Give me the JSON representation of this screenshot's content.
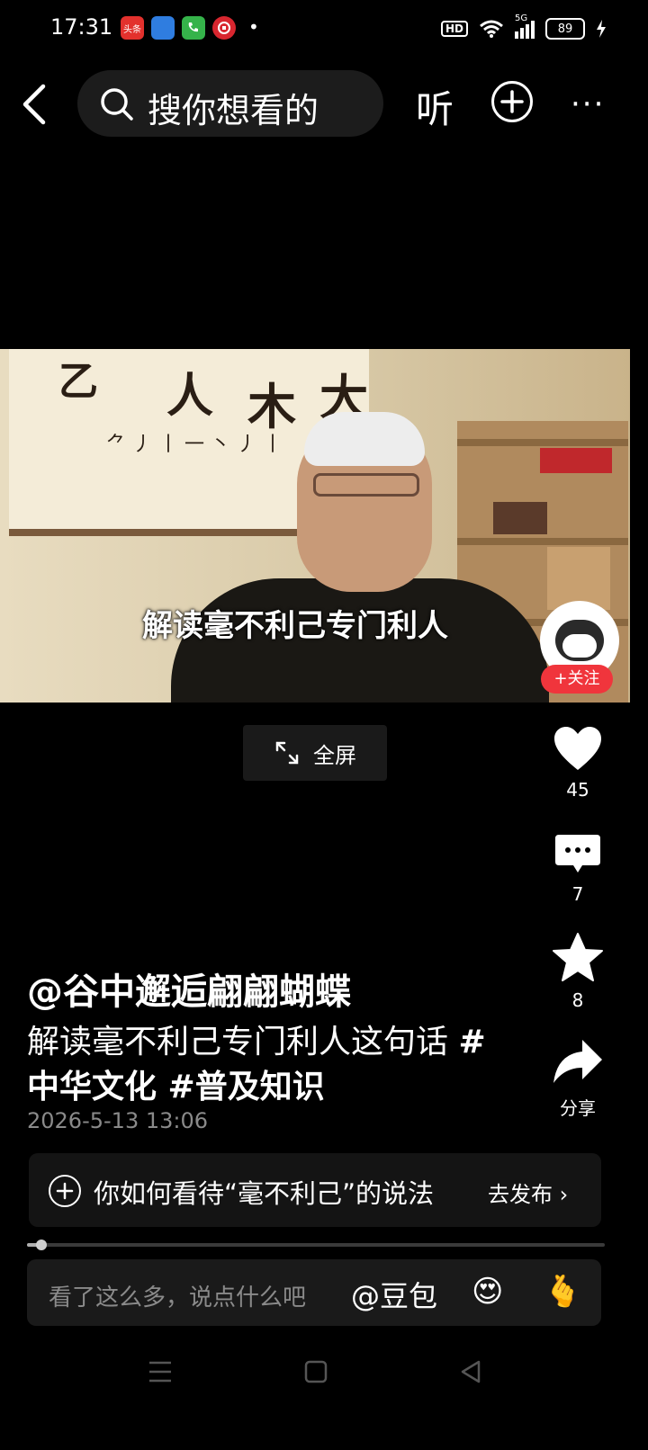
{
  "status_bar": {
    "time": "17:31",
    "apps": [
      "头条",
      "",
      "",
      "",
      "•"
    ],
    "hd": "HD",
    "signal": "5G",
    "battery": "89"
  },
  "top_nav": {
    "search_placeholder": "搜你想看的",
    "listen_label": "听",
    "more_label": "···"
  },
  "video": {
    "subtitle": "解读毫不利己专门利人",
    "follow_label": "+关注"
  },
  "fullscreen_label": "全屏",
  "actions": {
    "like_count": "45",
    "comment_count": "7",
    "favorite_count": "8",
    "share_label": "分享"
  },
  "post": {
    "author": "@谷中邂逅翩翩蝴蝶",
    "caption_text": "解读毫不利己专门利人这句话 ",
    "tag1": "#",
    "tag_line2": "中华文化 #普及知识",
    "timestamp": "2026-5-13 13:06"
  },
  "topic": {
    "text": "你如何看待“毫不利己”的说法",
    "publish_label": "去发布 ›"
  },
  "playback": {
    "progress_fraction": 0.02
  },
  "comment_bar": {
    "placeholder": "看了这么多，说点什么吧",
    "doubao_label": "@豆包",
    "emoji": "😍",
    "heart_hand": "🫰"
  },
  "colors": {
    "accent_red": "#f0353c",
    "background": "#000000"
  }
}
